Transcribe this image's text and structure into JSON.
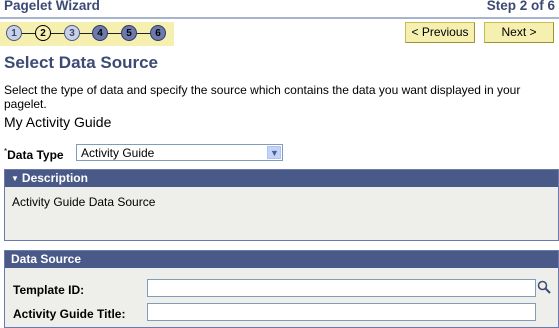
{
  "header": {
    "title": "Pagelet Wizard",
    "step": "Step 2 of 6"
  },
  "steps": [
    "1",
    "2",
    "3",
    "4",
    "5",
    "6"
  ],
  "nav": {
    "previous": "< Previous",
    "next": "Next >"
  },
  "page": {
    "title": "Select Data Source",
    "instructions": "Select the type of data and specify the source which contains the data you want displayed in your pagelet.",
    "guide_name": "My Activity Guide"
  },
  "data_type": {
    "required_mark": "*",
    "label": "Data Type",
    "value": "Activity Guide"
  },
  "description": {
    "title": "Description",
    "text": "Activity Guide Data Source"
  },
  "data_source": {
    "title": "Data Source",
    "template_id_label": "Template ID:",
    "template_id_value": "",
    "guide_title_label": "Activity Guide Title:",
    "guide_title_value": ""
  },
  "icons": [
    "search-icon",
    "caret-down-icon",
    "dropdown-arrow-icon"
  ],
  "colors": {
    "header_text": "#3c4a74",
    "panel_header": "#4a5a88",
    "button_bg": "#f5efb0"
  }
}
